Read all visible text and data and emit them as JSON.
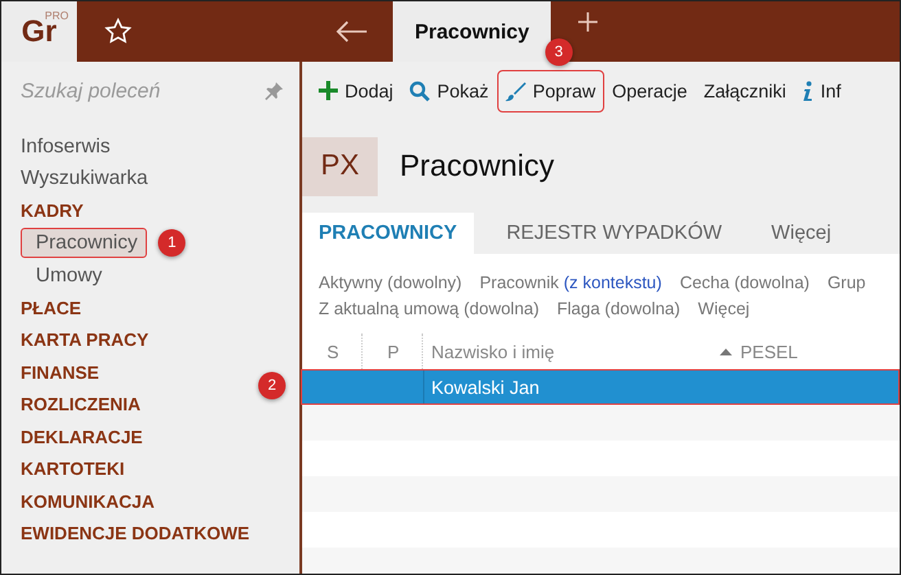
{
  "logo": {
    "text": "Gr",
    "sup": "PRO"
  },
  "tabs": [
    {
      "label": "Pracownicy",
      "selected": true
    }
  ],
  "search": {
    "placeholder": "Szukaj poleceń"
  },
  "sidebar": [
    {
      "label": "Infoserwis",
      "kind": "link",
      "selected": false
    },
    {
      "label": "Wyszukiwarka",
      "kind": "link",
      "selected": false
    },
    {
      "label": "KADRY",
      "kind": "section",
      "selected": false
    },
    {
      "label": "Pracownicy",
      "kind": "sub",
      "selected": true,
      "callout": "1"
    },
    {
      "label": "Umowy",
      "kind": "sub",
      "selected": false
    },
    {
      "label": "PŁACE",
      "kind": "section",
      "selected": false
    },
    {
      "label": "KARTA PRACY",
      "kind": "section",
      "selected": false
    },
    {
      "label": "FINANSE",
      "kind": "section",
      "selected": false
    },
    {
      "label": "ROZLICZENIA",
      "kind": "section",
      "selected": false
    },
    {
      "label": "DEKLARACJE",
      "kind": "section",
      "selected": false
    },
    {
      "label": "KARTOTEKI",
      "kind": "section",
      "selected": false
    },
    {
      "label": "KOMUNIKACJA",
      "kind": "section",
      "selected": false
    },
    {
      "label": "EWIDENCJE DODATKOWE",
      "kind": "section",
      "selected": false
    }
  ],
  "toolbar": [
    {
      "label": "Dodaj",
      "kind": "add",
      "outlined": false
    },
    {
      "label": "Pokaż",
      "kind": "show",
      "outlined": false
    },
    {
      "label": "Popraw",
      "kind": "edit",
      "outlined": true,
      "callout": "3"
    },
    {
      "label": "Operacje",
      "kind": "plain",
      "outlined": false
    },
    {
      "label": "Załączniki",
      "kind": "plain",
      "outlined": false
    },
    {
      "label": "Inf",
      "kind": "info",
      "outlined": false
    }
  ],
  "header": {
    "badge": "PX",
    "title": "Pracownicy"
  },
  "subtabs": [
    {
      "label": "PRACOWNICY",
      "selected": true
    },
    {
      "label": "REJESTR WYPADKÓW",
      "selected": false
    },
    {
      "label": "Więcej",
      "selected": false
    }
  ],
  "filters": [
    [
      {
        "label": "Aktywny",
        "value": "(dowolny)",
        "set": false
      },
      {
        "label": "Pracownik",
        "value": "(z kontekstu)",
        "set": true
      },
      {
        "label": "Cecha",
        "value": "(dowolna)",
        "set": false
      },
      {
        "label": "Grup"
      }
    ],
    [
      {
        "label": "Z aktualną umową",
        "value": "(dowolna)",
        "set": false
      },
      {
        "label": "Flaga",
        "value": "(dowolna)",
        "set": false
      },
      {
        "label": "Więcej"
      }
    ]
  ],
  "columns": [
    {
      "label": "S",
      "kind": "narrow"
    },
    {
      "label": "P",
      "kind": "narrow"
    },
    {
      "label": "Nazwisko i imię",
      "kind": "name"
    },
    {
      "label": "PESEL",
      "kind": "sorted"
    }
  ],
  "rows": [
    {
      "name": "Kowalski Jan",
      "selected": true,
      "callout": "2"
    }
  ]
}
